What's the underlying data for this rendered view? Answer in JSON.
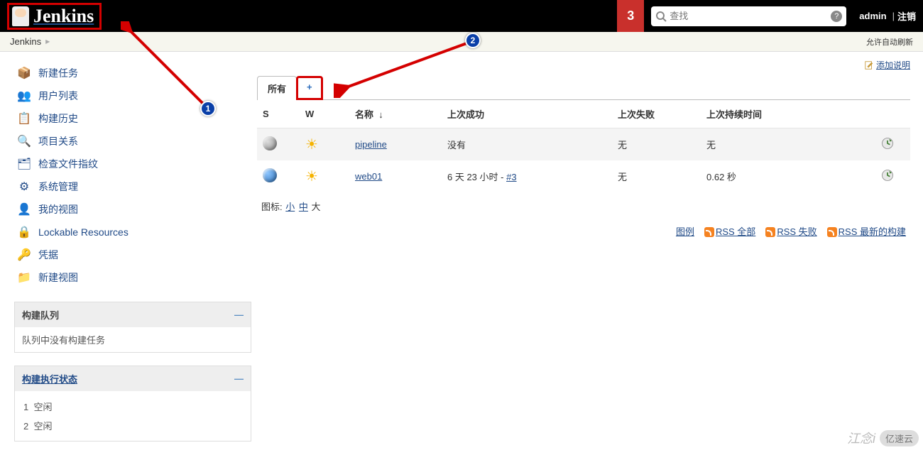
{
  "header": {
    "logo_text": "Jenkins",
    "notif_count": "3",
    "search_placeholder": "查找",
    "user": "admin",
    "logout": "注销",
    "sep": "|"
  },
  "breadcrumb": {
    "root": "Jenkins",
    "auto_refresh": "允许自动刷新"
  },
  "sidebar": {
    "items": [
      {
        "label": "新建任务",
        "icon": "📦"
      },
      {
        "label": "用户列表",
        "icon": "👥"
      },
      {
        "label": "构建历史",
        "icon": "📋"
      },
      {
        "label": "项目关系",
        "icon": "🔍"
      },
      {
        "label": "检查文件指纹",
        "icon": "🗂"
      },
      {
        "label": "系统管理",
        "icon": "⚙"
      },
      {
        "label": "我的视图",
        "icon": "👤"
      },
      {
        "label": "Lockable Resources",
        "icon": "🔒"
      },
      {
        "label": "凭据",
        "icon": "🔑"
      },
      {
        "label": "新建视图",
        "icon": "📁"
      }
    ],
    "queue_title": "构建队列",
    "queue_empty": "队列中没有构建任务",
    "exec_title": "构建执行状态",
    "exec": [
      {
        "n": "1",
        "state": "空闲"
      },
      {
        "n": "2",
        "state": "空闲"
      }
    ]
  },
  "main": {
    "add_desc": "添加说明",
    "tabs": {
      "all": "所有",
      "add": "+"
    },
    "cols": {
      "s": "S",
      "w": "W",
      "name": "名称",
      "name_arrow": "↓",
      "last_success": "上次成功",
      "last_fail": "上次失败",
      "duration": "上次持续时间"
    },
    "rows": [
      {
        "status": "grey",
        "name": "pipeline",
        "last_success": "没有",
        "last_fail": "无",
        "duration": "无"
      },
      {
        "status": "blue",
        "name": "web01",
        "last_success_text": "6 天 23 小时 - ",
        "last_success_build": "#3",
        "last_fail": "无",
        "duration": "0.62 秒"
      }
    ],
    "icon_legend": {
      "prefix": "图标:",
      "small": "小",
      "med": "中",
      "large": "大"
    },
    "footer": {
      "legend": "图例",
      "rss_all": "RSS 全部",
      "rss_fail": "RSS 失败",
      "rss_latest": "RSS 最新的构建"
    }
  },
  "annot": {
    "n1": "1",
    "n2": "2"
  },
  "watermark": {
    "text": "江念i",
    "brand": "亿速云"
  }
}
